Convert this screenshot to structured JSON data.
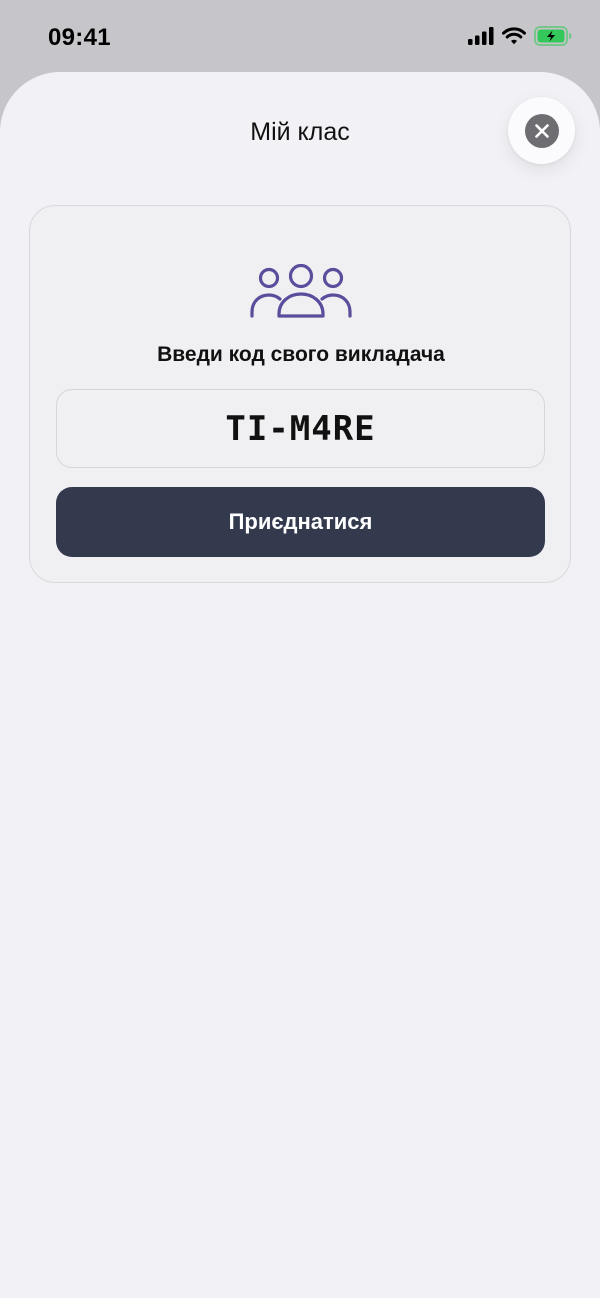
{
  "status_bar": {
    "time": "09:41"
  },
  "sheet": {
    "title": "Мій клас"
  },
  "join_card": {
    "prompt": "Введи код свого викладача",
    "code_value": "TI-M4RE",
    "join_label": "Приєднатися"
  },
  "icons": {
    "close": "close-icon",
    "group": "group-icon",
    "signal": "cellular-signal-icon",
    "wifi": "wifi-icon",
    "battery": "battery-charging-icon"
  },
  "colors": {
    "accent_icon": "#5b4d9c",
    "button_bg": "#333a4e",
    "battery_green": "#34c759"
  }
}
